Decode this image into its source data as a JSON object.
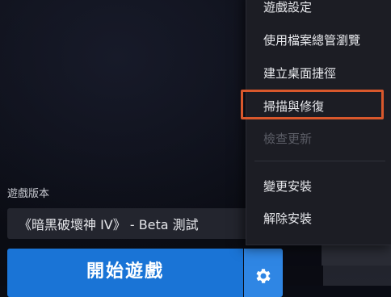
{
  "launcher": {
    "version_label": "遊戲版本",
    "version_selected": "《暗黑破壞神 IV》 - Beta 測試",
    "play_label": "開始遊戲",
    "settings_icon": "gear-icon"
  },
  "menu": {
    "items": [
      {
        "label": "遊戲設定",
        "enabled": true
      },
      {
        "label": "使用檔案總管瀏覽",
        "enabled": true
      },
      {
        "label": "建立桌面捷徑",
        "enabled": true
      },
      {
        "label": "掃描與修復",
        "enabled": true,
        "highlighted": true
      },
      {
        "label": "檢查更新",
        "enabled": false
      },
      {
        "label": "變更安裝",
        "enabled": true
      },
      {
        "label": "解除安裝",
        "enabled": true
      }
    ]
  },
  "colors": {
    "accent": "#1a74d6",
    "highlight": "#d9582c"
  }
}
